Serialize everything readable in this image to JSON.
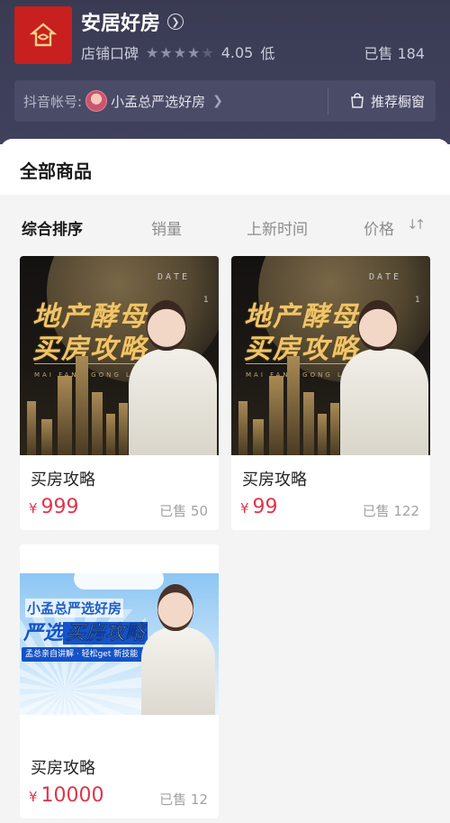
{
  "shop": {
    "name": "安居好房",
    "reputation_label": "店铺口碑",
    "rating": "4.05",
    "rating_level": "低",
    "stars_filled": 4,
    "stars_total": 5,
    "sold_total": "已售 184",
    "account_label": "抖音帐号:",
    "account_name": "小孟总严选好房",
    "recommend_window": "推荐橱窗"
  },
  "main": {
    "title": "全部商品",
    "sort_tabs": [
      "综合排序",
      "销量",
      "上新时间",
      "价格"
    ]
  },
  "products": [
    {
      "title": "买房攻略",
      "price": "999",
      "currency": "¥",
      "sold": "已售 50",
      "poster": {
        "date_label": "DATE",
        "date_num": "1",
        "line1": "地产酵母",
        "line2": "买房攻略",
        "sub": "MAI FANG GONG LUE"
      }
    },
    {
      "title": "买房攻略",
      "price": "99",
      "currency": "¥",
      "sold": "已售 122",
      "poster": {
        "date_label": "DATE",
        "date_num": "1",
        "line1": "地产酵母",
        "line2": "买房攻略",
        "sub": "MAI FANG GONG LUE"
      }
    },
    {
      "title": "买房攻略",
      "price": "10000",
      "currency": "¥",
      "sold": "已售 12",
      "poster": {
        "line1": "小孟总严选好房",
        "line2a": "严选",
        "line2b": "买房攻略",
        "ribbon": "孟总亲自讲解 · 轻松get 新技能"
      }
    }
  ],
  "colors": {
    "header_bg": "#3a3b53",
    "price_red": "#e0364a",
    "logo_red": "#c81f1f",
    "poster_gold": "#f0c468"
  }
}
